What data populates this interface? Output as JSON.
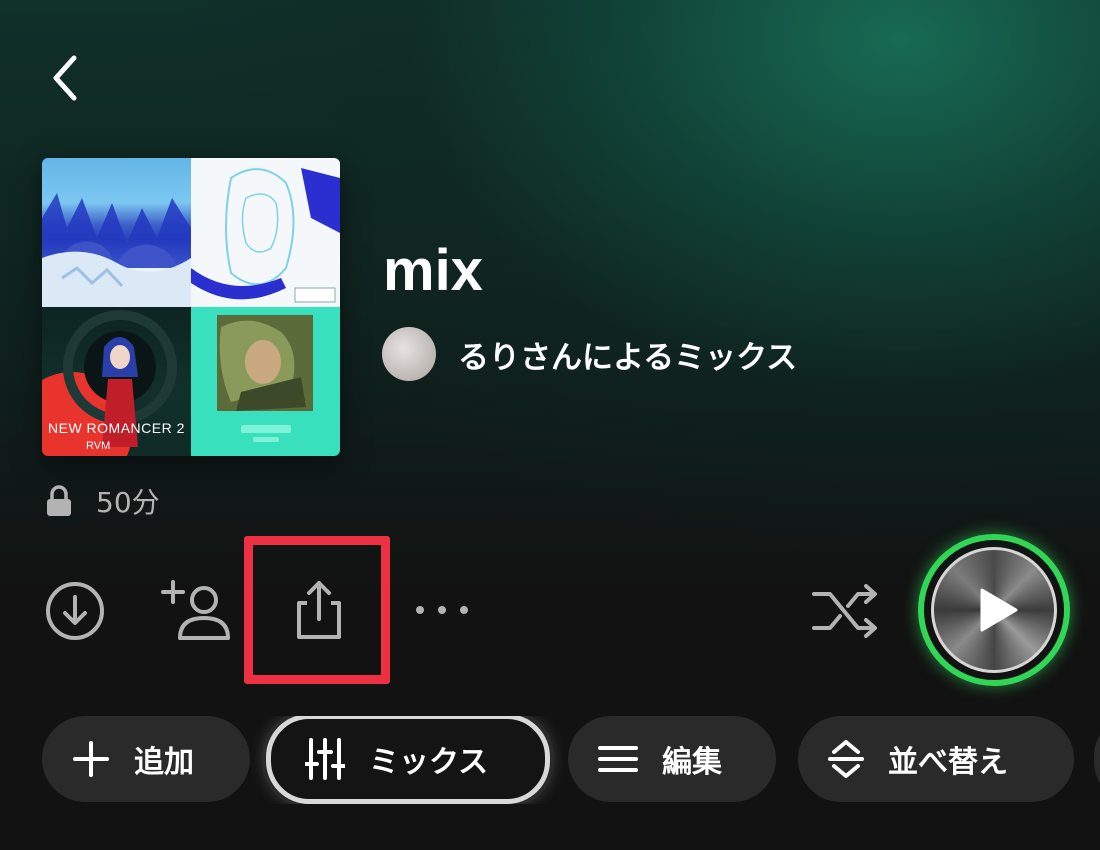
{
  "header": {
    "back_icon": "chevron-left-icon"
  },
  "playlist": {
    "title": "mix",
    "owner_text": "るりさんによるミックス",
    "duration": "50分",
    "cover": {
      "tile3_caption": "NEW ROMANCER 2",
      "tile3_subcaption": "RVM"
    }
  },
  "actions": {
    "download_icon": "download-circle-icon",
    "add_user_icon": "add-user-icon",
    "share_icon": "share-icon",
    "more_icon": "more-horizontal-icon",
    "shuffle_icon": "shuffle-icon",
    "play_icon": "play-icon"
  },
  "chips": {
    "add_label": "追加",
    "mix_label": "ミックス",
    "edit_label": "編集",
    "sort_label": "並べ替え"
  },
  "colors": {
    "accent_green": "#32d656",
    "highlight_red": "#ee3043",
    "chip_bg": "#2a2a2a"
  }
}
